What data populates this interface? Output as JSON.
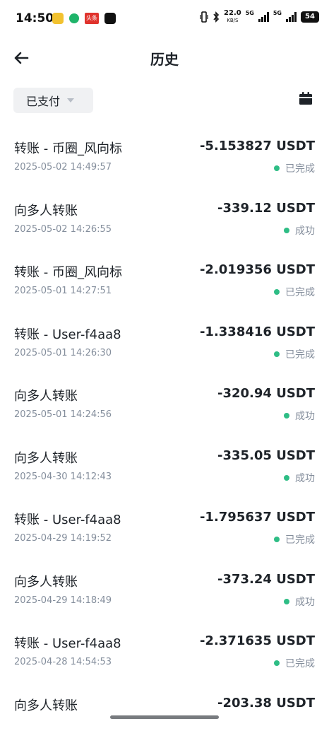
{
  "status_bar": {
    "time": "14:50",
    "net_speed": "22.0",
    "net_speed_unit": "KB/S",
    "sim1": "5G",
    "sim2": "5G",
    "battery": "54",
    "app_badge": "头条"
  },
  "header": {
    "title": "历史"
  },
  "filter": {
    "label": "已支付"
  },
  "transactions": [
    {
      "title": "转账 - 币圈_风向标",
      "amount": "-5.153827 USDT",
      "time": "2025-05-02 14:49:57",
      "status": "已完成"
    },
    {
      "title": "向多人转账",
      "amount": "-339.12 USDT",
      "time": "2025-05-02 14:26:55",
      "status": "成功"
    },
    {
      "title": "转账 - 币圈_风向标",
      "amount": "-2.019356 USDT",
      "time": "2025-05-01 14:27:51",
      "status": "已完成"
    },
    {
      "title": "转账 - User-f4aa8",
      "amount": "-1.338416 USDT",
      "time": "2025-05-01 14:26:30",
      "status": "已完成"
    },
    {
      "title": "向多人转账",
      "amount": "-320.94 USDT",
      "time": "2025-05-01 14:24:56",
      "status": "成功"
    },
    {
      "title": "向多人转账",
      "amount": "-335.05 USDT",
      "time": "2025-04-30 14:12:43",
      "status": "成功"
    },
    {
      "title": "转账 - User-f4aa8",
      "amount": "-1.795637 USDT",
      "time": "2025-04-29 14:19:52",
      "status": "已完成"
    },
    {
      "title": "向多人转账",
      "amount": "-373.24 USDT",
      "time": "2025-04-29 14:18:49",
      "status": "成功"
    },
    {
      "title": "转账 - User-f4aa8",
      "amount": "-2.371635 USDT",
      "time": "2025-04-28 14:54:53",
      "status": "已完成"
    },
    {
      "title": "向多人转账",
      "amount": "-203.38 USDT",
      "time": "",
      "status": ""
    }
  ],
  "colors": {
    "text_primary": "#1e2329",
    "text_secondary": "#848e9c",
    "status_success": "#2ebd85",
    "filter_bg": "#f0f1f3"
  }
}
